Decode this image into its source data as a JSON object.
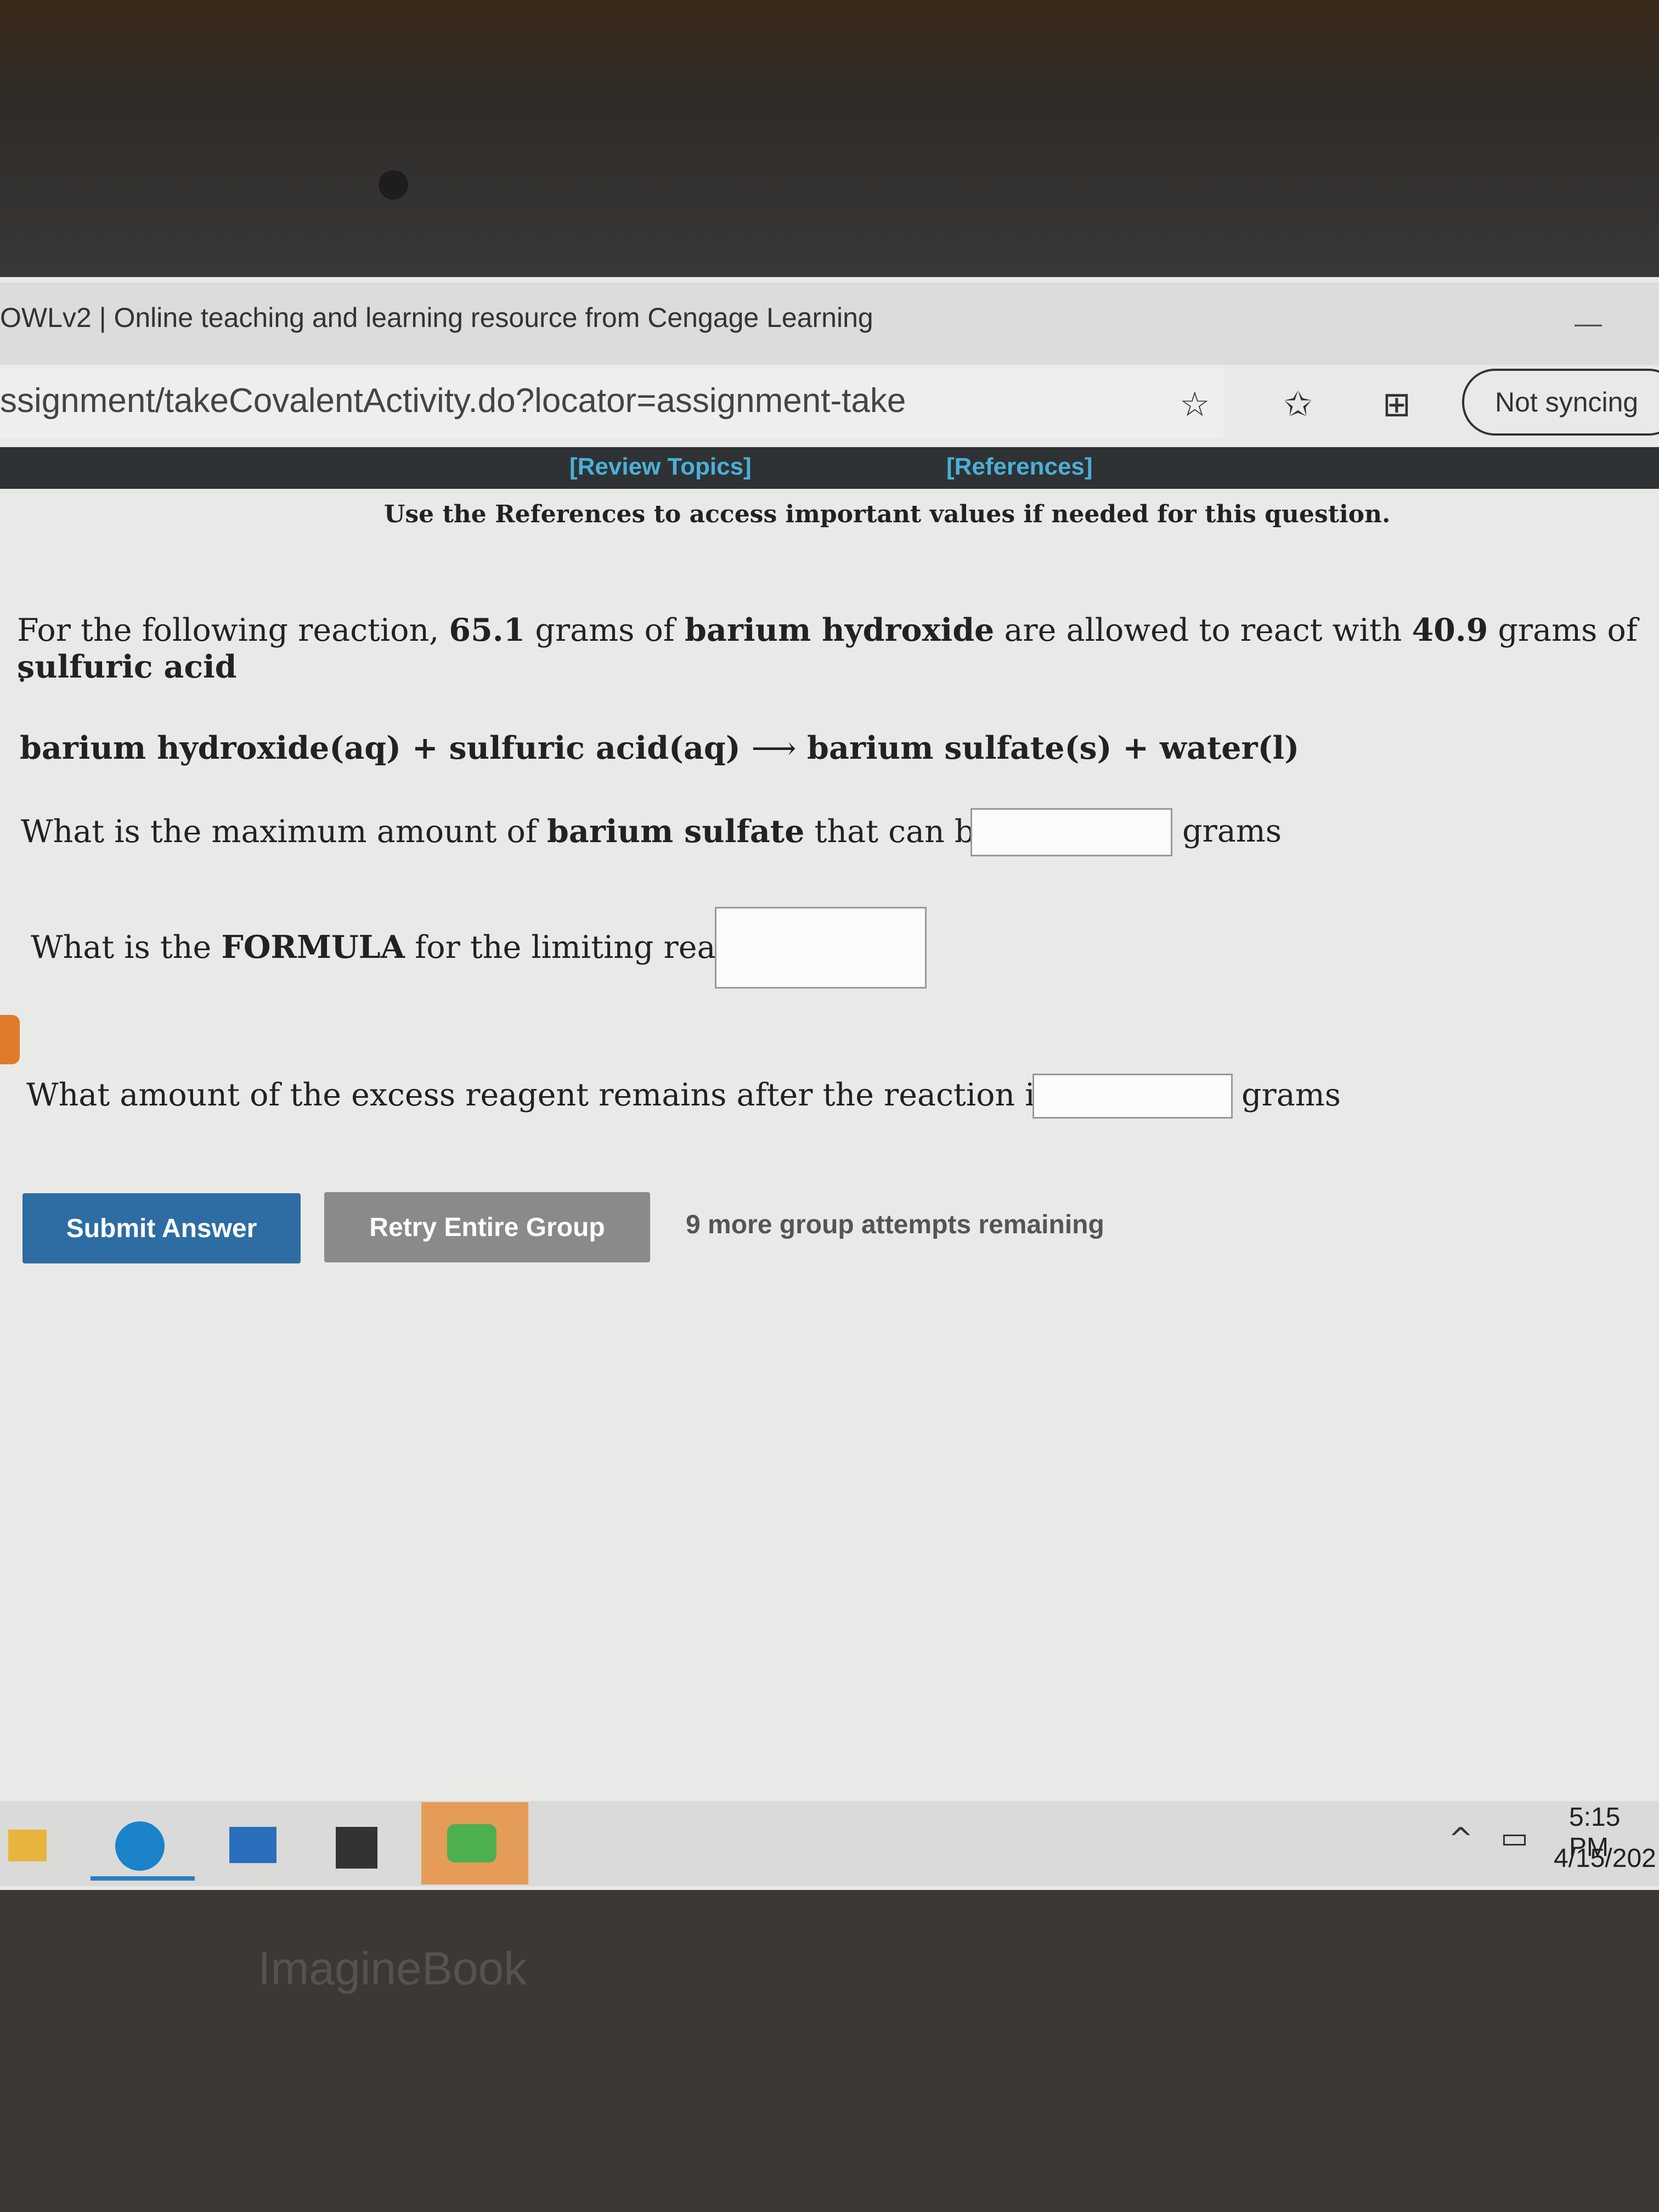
{
  "browser": {
    "tab_title": "OWLv2 | Online teaching and learning resource from Cengage Learning",
    "url": "ssignment/takeCovalentActivity.do?locator=assignment-take",
    "sync_label": "Not syncing",
    "icons": [
      "add-favorite-icon",
      "favorites-icon",
      "collections-icon"
    ]
  },
  "nav": {
    "review_topics": "[Review Topics]",
    "references": "[References]"
  },
  "reference_note": "Use the References to access important values if needed for this question.",
  "question": {
    "intro_parts": [
      "For the following reaction, ",
      "65.1",
      " grams of ",
      "barium hydroxide",
      " are allowed to react with ",
      "40.9",
      " grams of ",
      "sulfuric acid"
    ],
    "period": ".",
    "equation_left": "barium hydroxide(aq) + sulfuric acid(aq)",
    "arrow": "⟶",
    "equation_right": "barium sulfate(s) + water(l)",
    "q1_parts": [
      "What is the maximum amount of ",
      "barium sulfate",
      " that can be formed?"
    ],
    "q1_unit": "grams",
    "q1_value": "",
    "q2_parts": [
      "What is the ",
      "FORMULA",
      " for the limiting reagent?"
    ],
    "q2_value": "",
    "q3": "What amount of the excess reagent remains after the reaction is complete?",
    "q3_unit": "grams",
    "q3_value": ""
  },
  "actions": {
    "submit": "Submit Answer",
    "retry": "Retry Entire Group",
    "attempts": "9 more group attempts remaining"
  },
  "colors": {
    "submit": "#2e6da4",
    "retry": "#8a8a8a",
    "nav_bar": "#2f3234",
    "nav_link": "#4ab0d8"
  },
  "taskbar": {
    "apps": [
      "file-explorer",
      "edge",
      "mail",
      "store",
      "spotify"
    ],
    "time": "5:15 PM",
    "date": "4/15/202"
  },
  "device_brand": "ImagineBook"
}
